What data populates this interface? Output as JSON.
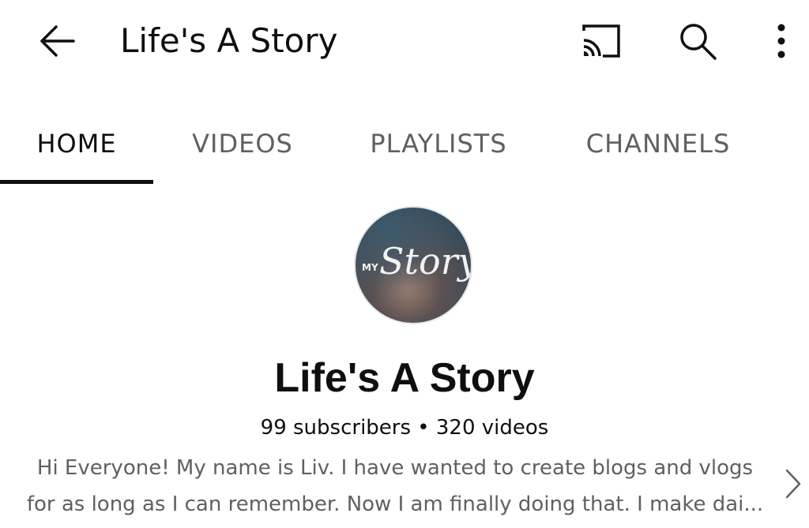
{
  "header": {
    "title": "Life's A Story",
    "back_icon": "arrow-left-icon",
    "cast_icon": "cast-icon",
    "search_icon": "search-icon",
    "more_icon": "more-vert-icon"
  },
  "tabs": [
    {
      "label": "HOME",
      "active": true
    },
    {
      "label": "VIDEOS",
      "active": false
    },
    {
      "label": "PLAYLISTS",
      "active": false
    },
    {
      "label": "CHANNELS",
      "active": false
    }
  ],
  "channel": {
    "avatar_text_small": "MY",
    "avatar_text_script": "Story",
    "name": "Life's A Story",
    "stats": "99 subscribers • 320 videos",
    "description_line1": "Hi Everyone! My name is Liv. I have wanted to create blogs and vlogs",
    "description_line2": "for as long as I can remember. Now I am finally doing that. I make dai..."
  },
  "colors": {
    "text_primary": "#0f0f0f",
    "text_secondary": "#606060",
    "background": "#ffffff"
  }
}
